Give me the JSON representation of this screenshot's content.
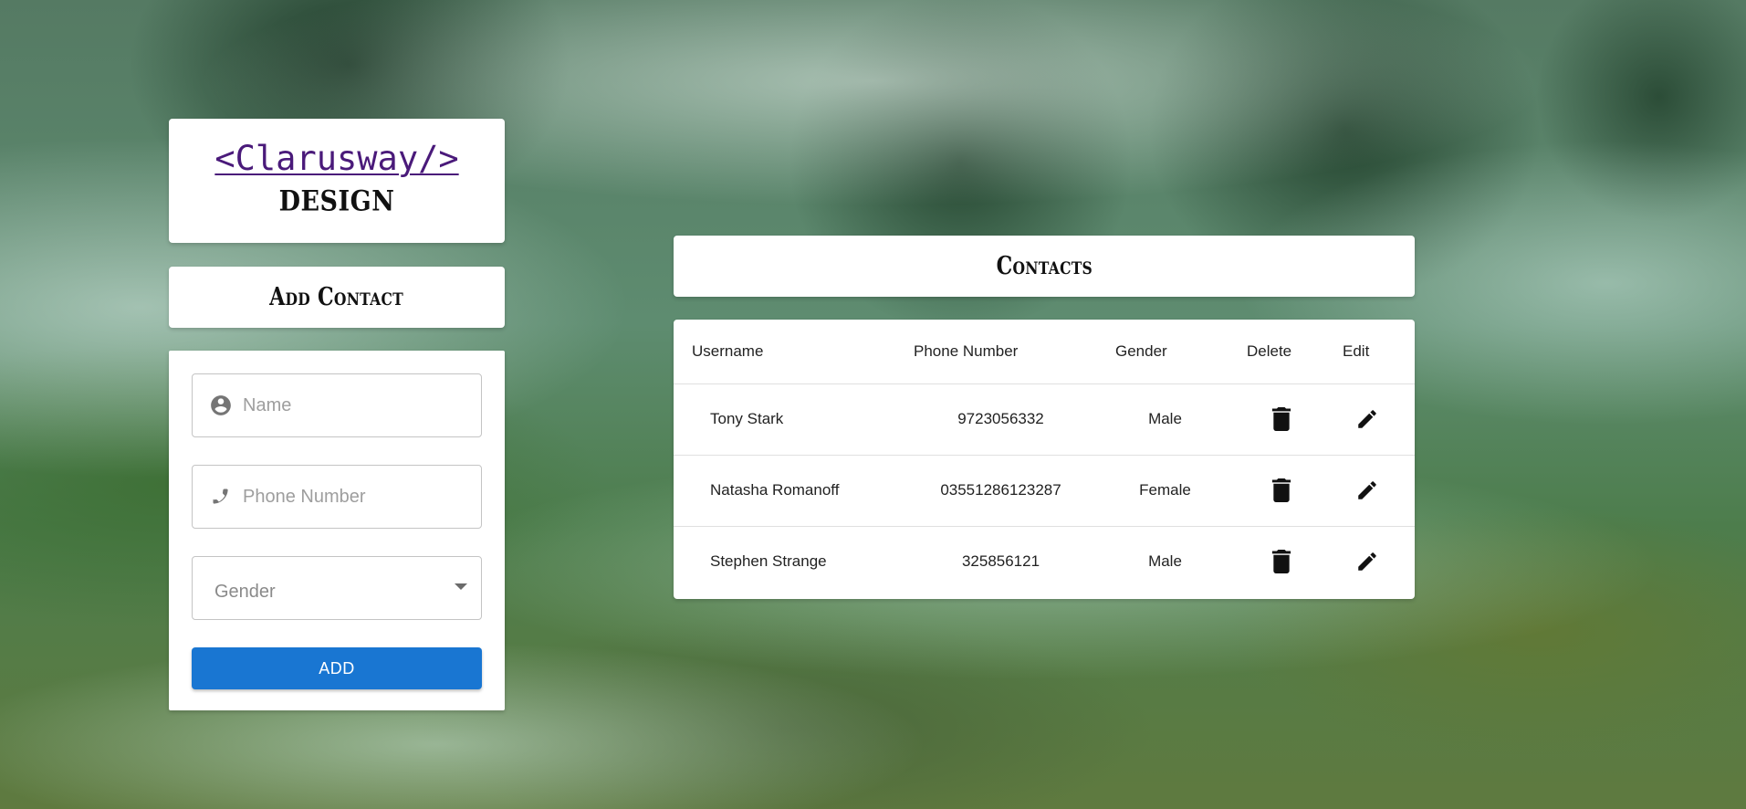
{
  "brand": {
    "logo_text": "<Clarusway/>",
    "subtitle": "DESIGN",
    "logo_color": "#4a1a7a"
  },
  "add_contact": {
    "title": "Add Contact",
    "name_placeholder": "Name",
    "phone_placeholder": "Phone Number",
    "gender_label": "Gender",
    "add_button_label": "ADD",
    "add_button_color": "#1976d2",
    "icons": [
      "account-circle-icon",
      "phone-icon",
      "chevron-down-icon"
    ]
  },
  "contacts": {
    "title": "Contacts",
    "columns": [
      "Username",
      "Phone Number",
      "Gender",
      "Delete",
      "Edit"
    ],
    "rows": [
      {
        "username": "Tony Stark",
        "phone": "9723056332",
        "gender": "Male"
      },
      {
        "username": "Natasha Romanoff",
        "phone": "03551286123287",
        "gender": "Female"
      },
      {
        "username": "Stephen Strange",
        "phone": "325856121",
        "gender": "Male"
      }
    ],
    "row_icons": [
      "trash-icon",
      "pencil-icon"
    ]
  }
}
